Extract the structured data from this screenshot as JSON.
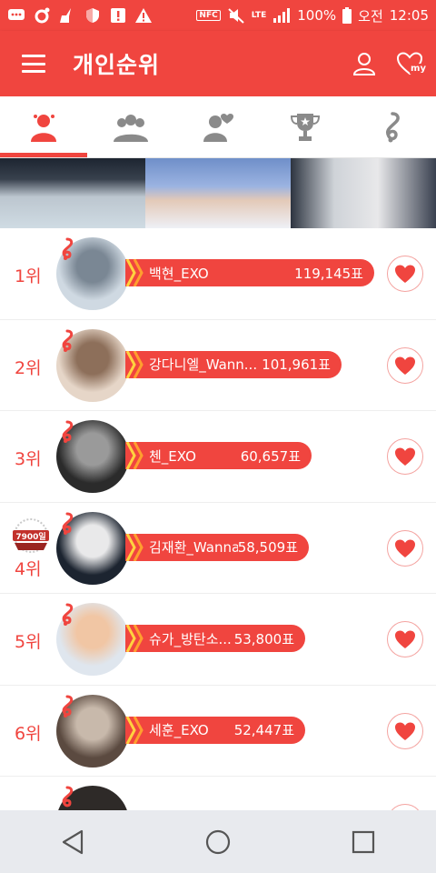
{
  "status": {
    "battery": "100%",
    "network": "LTE",
    "ampm": "오전",
    "time": "12:05",
    "nfc": "NFC"
  },
  "app_bar": {
    "title": "개인순위",
    "accent_color": "#f0453f",
    "my_label": "my"
  },
  "tabs": [
    {
      "icon": "person-icon",
      "active": true
    },
    {
      "icon": "group-icon",
      "active": false
    },
    {
      "icon": "heart-person-icon",
      "active": false
    },
    {
      "icon": "trophy-icon",
      "active": false
    },
    {
      "icon": "music-note-icon",
      "active": false
    }
  ],
  "ranking": [
    {
      "rank": "1위",
      "name": "백현_EXO",
      "votes": "119,145표",
      "fill": 0.76
    },
    {
      "rank": "2위",
      "name": "강다니엘_Wann...",
      "votes": "101,961표",
      "fill": 0.66
    },
    {
      "rank": "3위",
      "name": "첸_EXO",
      "votes": "60,657표",
      "fill": 0.57
    },
    {
      "rank": "4위",
      "name": "김재환_Wanna...",
      "votes": "58,509표",
      "fill": 0.56,
      "medal": "7900일"
    },
    {
      "rank": "5위",
      "name": "슈가_방탄소...",
      "votes": "53,800표",
      "fill": 0.55
    },
    {
      "rank": "6위",
      "name": "세훈_EXO",
      "votes": "52,447표",
      "fill": 0.55
    }
  ]
}
